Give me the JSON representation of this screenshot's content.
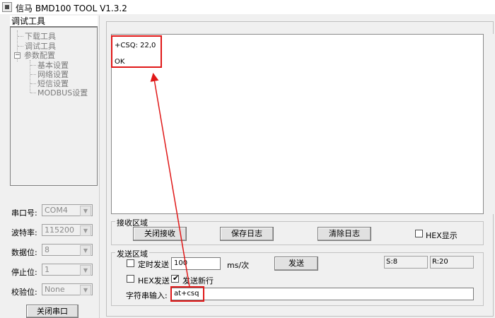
{
  "window": {
    "title": "信马 BMD100 TOOL V1.3.2"
  },
  "tree": {
    "header": "调试工具",
    "items": [
      {
        "label": "下载工具"
      },
      {
        "label": "调试工具"
      },
      {
        "label": "参数配置"
      },
      {
        "label": "基本设置"
      },
      {
        "label": "网络设置"
      },
      {
        "label": "短信设置"
      },
      {
        "label": "MODBUS设置"
      }
    ]
  },
  "serial": {
    "port": {
      "label": "串口号:",
      "value": "COM4"
    },
    "baud": {
      "label": "波特率:",
      "value": "115200"
    },
    "databits": {
      "label": "数据位:",
      "value": "8"
    },
    "stopbits": {
      "label": "停止位:",
      "value": "1"
    },
    "parity": {
      "label": "校验位:",
      "value": "None"
    },
    "close_button": "关闭串口"
  },
  "receive": {
    "lines": [
      "+CSQ: 22,0",
      "OK"
    ],
    "group_title": "接收区域",
    "close_recv_button": "关闭接收",
    "save_log_button": "保存日志",
    "clear_log_button": "清除日志",
    "hex_display_label": "HEX显示",
    "hex_display_checked": false
  },
  "send": {
    "group_title": "发送区域",
    "timed_send_label": "定时发送",
    "timed_send_checked": false,
    "interval_value": "100",
    "interval_unit": "ms/次",
    "send_button": "发送",
    "sent_count": "S:8",
    "recv_count": "R:20",
    "hex_send_label": "HEX发送",
    "hex_send_checked": false,
    "newline_label": "发送新行",
    "newline_checked": true,
    "string_input_label": "字符串输入:",
    "string_input_value": "at+csq"
  },
  "colors": {
    "highlight": "#e01818"
  }
}
